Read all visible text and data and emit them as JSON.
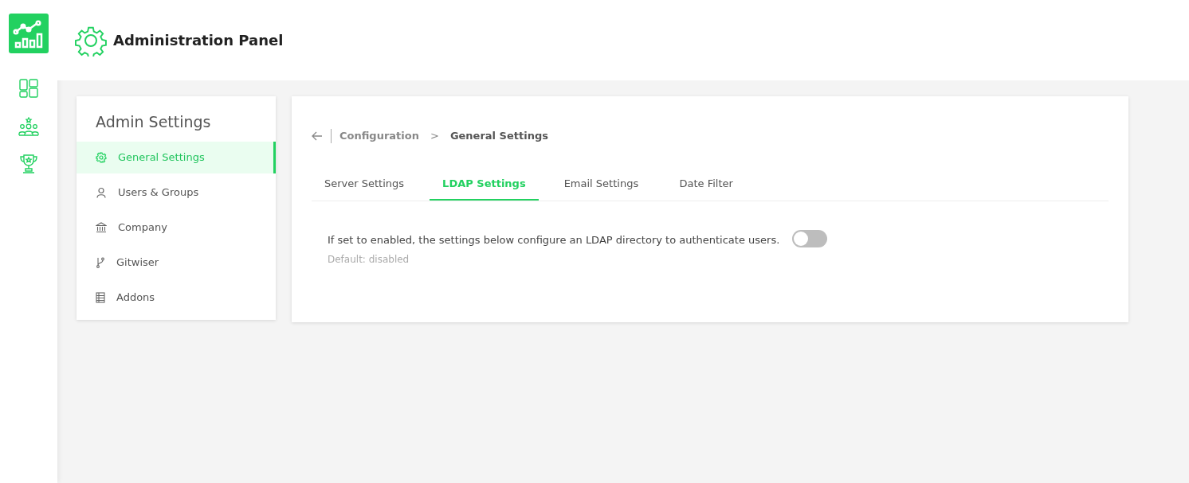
{
  "header": {
    "title": "Administration Panel"
  },
  "settings_menu": {
    "title": "Admin Settings",
    "items": [
      {
        "label": "General Settings",
        "selected": true
      },
      {
        "label": "Users & Groups",
        "selected": false
      },
      {
        "label": "Company",
        "selected": false
      },
      {
        "label": "Gitwiser",
        "selected": false
      },
      {
        "label": "Addons",
        "selected": false
      }
    ]
  },
  "breadcrumb": [
    "Configuration",
    ">",
    "General Settings"
  ],
  "tabs": [
    {
      "label": "Server Settings",
      "selected": false
    },
    {
      "label": "LDAP Settings",
      "selected": true
    },
    {
      "label": "Email Settings",
      "selected": false
    },
    {
      "label": "Date Filter",
      "selected": false
    }
  ],
  "ldap_setting": {
    "description": "If set to enabled, the settings below configure an LDAP directory to authenticate users.",
    "default": "Default: disabled",
    "on": false
  }
}
